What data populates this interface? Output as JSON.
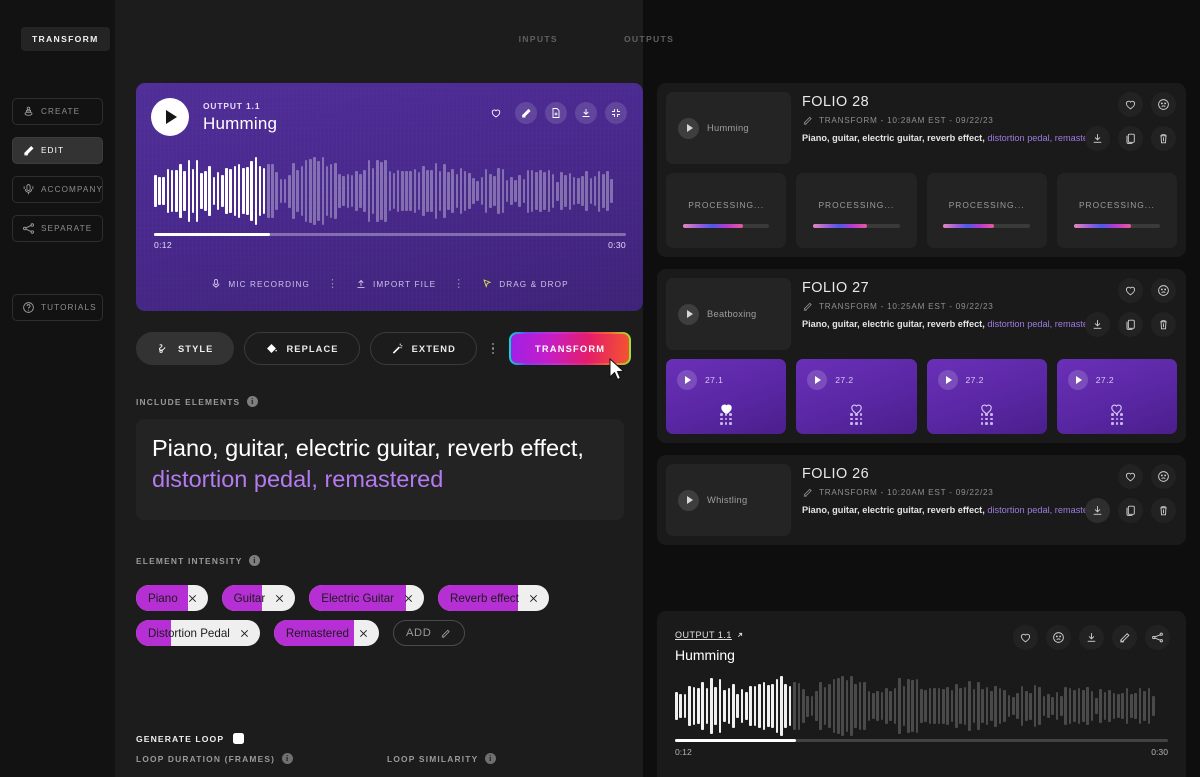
{
  "tabs": [
    {
      "label": "TRANSFORM",
      "active": true
    },
    {
      "label": "INPUTS",
      "active": false
    },
    {
      "label": "OUTPUTS",
      "active": false
    }
  ],
  "sidebar": {
    "items": [
      {
        "label": "CREATE",
        "icon": "create-icon",
        "active": false
      },
      {
        "label": "EDIT",
        "icon": "edit-pen-icon",
        "active": true
      },
      {
        "label": "ACCOMPANY",
        "icon": "microphone-music-icon",
        "active": false
      },
      {
        "label": "SEPARATE",
        "icon": "separate-nodes-icon",
        "active": false
      }
    ],
    "tutorials": {
      "label": "TUTORIALS",
      "icon": "question-circle-icon"
    }
  },
  "player": {
    "output_label": "OUTPUT 1.1",
    "title": "Humming",
    "time_current": "0:12",
    "time_total": "0:30",
    "progress_percent": 24.5,
    "actions": [
      {
        "name": "favorite-icon",
        "icon": "heart"
      },
      {
        "name": "edit-icon",
        "icon": "pen"
      },
      {
        "name": "new-file-icon",
        "icon": "file-plus"
      },
      {
        "name": "download-icon",
        "icon": "download"
      },
      {
        "name": "collapse-icon",
        "icon": "collapse"
      }
    ],
    "sources": [
      {
        "label": "MIC RECORDING",
        "icon": "microphone-icon"
      },
      {
        "label": "IMPORT FILE",
        "icon": "upload-icon"
      },
      {
        "label": "DRAG & DROP",
        "icon": "cursor-drag-icon"
      }
    ]
  },
  "action_row": {
    "buttons": [
      {
        "label": "STYLE",
        "icon": "style-icon",
        "active": true
      },
      {
        "label": "REPLACE",
        "icon": "paint-bucket-icon",
        "active": false
      },
      {
        "label": "EXTEND",
        "icon": "magic-wand-icon",
        "active": false
      }
    ],
    "transform_label": "TRANSFORM"
  },
  "include_elements": {
    "label": "INCLUDE ELEMENTS",
    "text_plain": "Piano, guitar, electric guitar, reverb effect, ",
    "text_highlight": "distortion pedal, remastered"
  },
  "element_intensity": {
    "label": "ELEMENT INTENSITY",
    "chips": [
      {
        "label": "Piano",
        "intensity": 72
      },
      {
        "label": "Guitar",
        "intensity": 55
      },
      {
        "label": "Electric Guitar",
        "intensity": 84
      },
      {
        "label": "Reverb effect",
        "intensity": 72
      },
      {
        "label": "Distortion Pedal",
        "intensity": 28
      },
      {
        "label": "Remastered",
        "intensity": 76
      }
    ],
    "add_label": "ADD"
  },
  "loop": {
    "generate_label": "GENERATE LOOP",
    "generate_enabled": true,
    "duration_label": "LOOP DURATION (FRAMES)",
    "similarity_label": "LOOP SIMILARITY"
  },
  "folios": [
    {
      "thumb_name": "Humming",
      "title": "FOLIO 28",
      "meta": "TRANSFORM - 10:28AM EST - 09/22/23",
      "desc_plain": "Piano, guitar, electric guitar, reverb effect, ",
      "desc_highlight": "distortion pedal, remastered",
      "tiles_type": "processing",
      "processing_label": "PROCESSING...",
      "tiles": [
        {
          "progress": 70
        },
        {
          "progress": 62
        },
        {
          "progress": 58
        },
        {
          "progress": 66
        }
      ],
      "download_active": false
    },
    {
      "thumb_name": "Beatboxing",
      "title": "FOLIO 27",
      "meta": "TRANSFORM - 10:25AM EST - 09/22/23",
      "desc_plain": "Piano, guitar, electric guitar, reverb effect, ",
      "desc_highlight": "distortion pedal, remastered",
      "tiles_type": "result",
      "tiles": [
        {
          "label": "27.1",
          "favorited": true
        },
        {
          "label": "27.2",
          "favorited": false
        },
        {
          "label": "27.2",
          "favorited": false
        },
        {
          "label": "27.2",
          "favorited": false
        }
      ],
      "download_active": false
    },
    {
      "thumb_name": "Whistling",
      "title": "FOLIO 26",
      "meta": "TRANSFORM - 10:20AM EST - 09/22/23",
      "desc_plain": "Piano, guitar, electric guitar, reverb effect, ",
      "desc_highlight": "distortion pedal, remastered",
      "tiles_type": "none",
      "tiles": [],
      "download_active": true
    }
  ],
  "folio_icons": [
    {
      "name": "favorite-icon"
    },
    {
      "name": "dislike-icon"
    },
    {
      "name": "download-icon"
    },
    {
      "name": "duplicate-icon"
    },
    {
      "name": "delete-icon"
    }
  ],
  "dock": {
    "output_label": "OUTPUT 1.1",
    "title": "Humming",
    "time_current": "0:12",
    "time_total": "0:30",
    "progress_percent": 24.5,
    "icons": [
      {
        "name": "favorite-icon"
      },
      {
        "name": "dislike-icon"
      },
      {
        "name": "download-icon"
      },
      {
        "name": "edit-icon"
      },
      {
        "name": "share-icon"
      }
    ]
  },
  "colors": {
    "accent_purple": "#b62fd4",
    "highlight_text": "#b47af0",
    "player_bg": "#512f99",
    "page_bg": "#0e0e0e"
  }
}
